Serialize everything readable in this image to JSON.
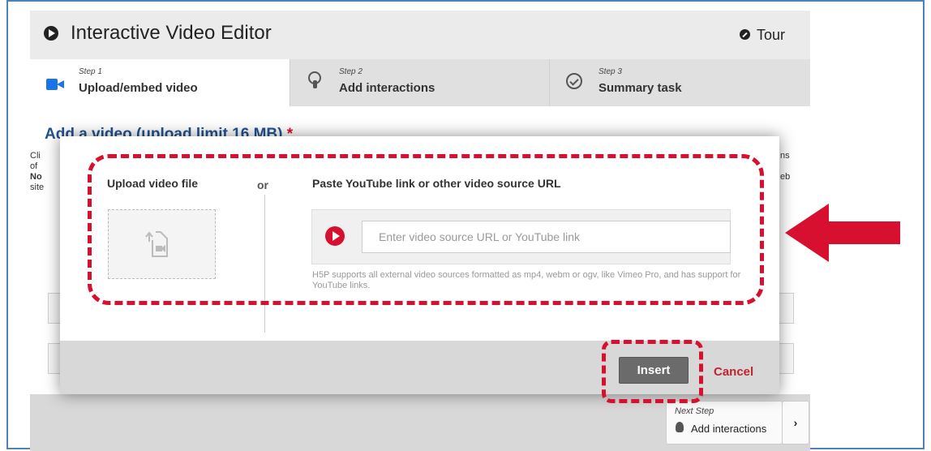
{
  "header": {
    "title": "Interactive Video Editor",
    "tour_label": "Tour"
  },
  "steps": [
    {
      "small": "Step 1",
      "label": "Upload/embed video"
    },
    {
      "small": "Step 2",
      "label": "Add interactions"
    },
    {
      "small": "Step 3",
      "label": "Summary task"
    }
  ],
  "main": {
    "heading": "Add a video (upload limit 16 MB)",
    "required_mark": "*",
    "left_fragments": [
      "Cli",
      "of",
      "No",
      "site"
    ],
    "right_fragments": [
      "ns",
      "eb"
    ]
  },
  "dialog": {
    "upload_label": "Upload video file",
    "or_label": "or",
    "paste_label": "Paste YouTube link or other video source URL",
    "url_placeholder": "Enter video source URL or YouTube link",
    "hint": "H5P supports all external video sources formatted as mp4, webm or ogv, like Vimeo Pro, and has support for YouTube links.",
    "insert_label": "Insert",
    "cancel_label": "Cancel"
  },
  "footer": {
    "next_small": "Next Step",
    "next_label": "Add interactions",
    "chevron": "›"
  },
  "colors": {
    "accent_red": "#d8102f",
    "heading_blue": "#24528f",
    "frame_blue": "#4f81bd"
  }
}
